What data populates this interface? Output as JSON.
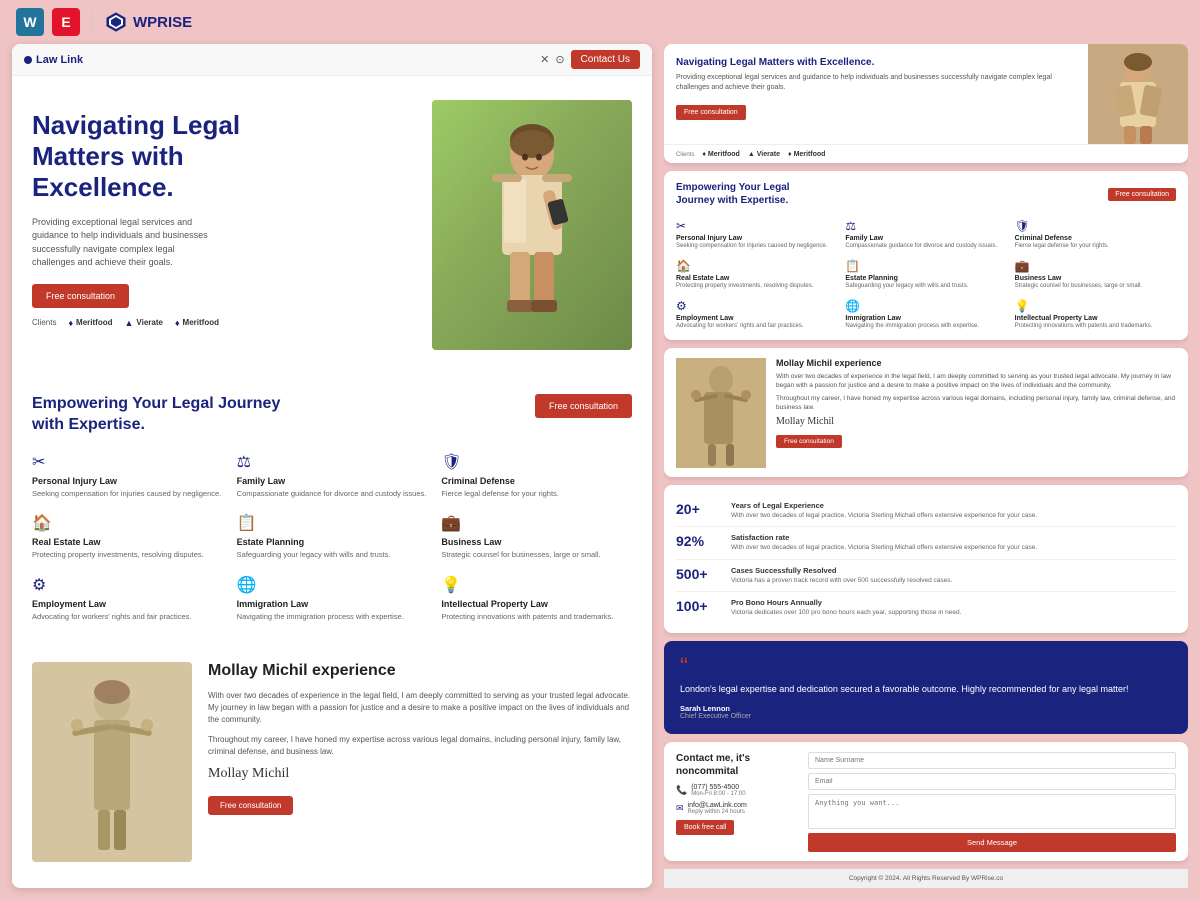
{
  "toolbar": {
    "wp_label": "W",
    "elementor_label": "E",
    "brand_name": "WPRISE",
    "divider": "|"
  },
  "browser": {
    "site_name": "Law Link",
    "x_icon": "✕",
    "instagram_icon": "⊙",
    "contact_btn": "Contact Us"
  },
  "hero": {
    "title_line1": "Navigating Legal",
    "title_line2": "Matters with",
    "title_line3": "Excellence.",
    "description": "Providing exceptional legal services and guidance to help individuals and businesses successfully navigate complex legal challenges and achieve their goals.",
    "cta_btn": "Free consultation",
    "clients_label": "Clients"
  },
  "clients": [
    {
      "name": "Meritfood",
      "icon": "♦"
    },
    {
      "name": "Vierate",
      "icon": "▲"
    },
    {
      "name": "Meritfood",
      "icon": "♦"
    }
  ],
  "services_section": {
    "title": "Empowering Your Legal Journey with Expertise.",
    "cta_btn": "Free consultation",
    "items": [
      {
        "icon": "✂",
        "name": "Personal Injury Law",
        "desc": "Seeking compensation for injuries caused by negligence."
      },
      {
        "icon": "⚖",
        "name": "Family Law",
        "desc": "Compassionate guidance for divorce and custody issues."
      },
      {
        "icon": "🛡",
        "name": "Criminal Defense",
        "desc": "Fierce legal defense for your rights."
      },
      {
        "icon": "🏠",
        "name": "Real Estate Law",
        "desc": "Protecting property investments, resolving disputes."
      },
      {
        "icon": "📋",
        "name": "Estate Planning",
        "desc": "Safeguarding your legacy with wills and trusts."
      },
      {
        "icon": "💼",
        "name": "Business Law",
        "desc": "Strategic counsel for businesses, large or small."
      },
      {
        "icon": "⚙",
        "name": "Employment Law",
        "desc": "Advocating for workers' rights and fair practices."
      },
      {
        "icon": "🌐",
        "name": "Immigration Law",
        "desc": "Navigating the immigration process with expertise."
      },
      {
        "icon": "💡",
        "name": "Intellectual Property Law",
        "desc": "Protecting innovations with patents and trademarks."
      }
    ]
  },
  "experience_section": {
    "title": "Mollay Michil experience",
    "para1": "With over two decades of experience in the legal field, I am deeply committed to serving as your trusted legal advocate. My journey in law began with a passion for justice and a desire to make a positive impact on the lives of individuals and the community.",
    "para2": "Throughout my career, I have honed my expertise across various legal domains, including personal injury, family law, criminal defense, and business law.",
    "signature": "Mollay Michil",
    "cta_btn": "Free consultation"
  },
  "stats": [
    {
      "number": "20+",
      "title": "Years of Legal Experience",
      "desc": "With over two decades of legal practice, Victoria Sterling Michail offers extensive experience for your case."
    },
    {
      "number": "92%",
      "title": "Satisfaction rate",
      "desc": "With over two decades of legal practice, Victoria Sterling Michail offers extensive experience for your case."
    },
    {
      "number": "500+",
      "title": "Cases Successfully Resolved",
      "desc": "Victoria has a proven track record with over 500 successfully resolved cases."
    },
    {
      "number": "100+",
      "title": "Pro Bono Hours Annually",
      "desc": "Victoria dedicates over 100 pro bono hours each year, supporting those in need."
    }
  ],
  "testimonial": {
    "quote_mark": "“",
    "text": "London's legal expertise and dedication secured a favorable outcome. Highly recommended for any legal matter!",
    "author": "Sarah Lennon",
    "role": "Chief Executive Officer"
  },
  "contact": {
    "title": "Contact me, it's noncommital",
    "phone": "(077) 555-4500",
    "phone_hours": "Mon-Fri 8:00 - 17:00",
    "email": "info@LawLink.com",
    "email_note": "Reply within 24 hours",
    "book_btn": "Book free call",
    "form": {
      "name_placeholder": "Name Surname",
      "email_placeholder": "Email",
      "message_placeholder": "Anything you want...",
      "send_btn": "Send Message"
    }
  },
  "footer": {
    "text": "Copyright © 2024. All Rights Reserved By WPRise.co"
  }
}
